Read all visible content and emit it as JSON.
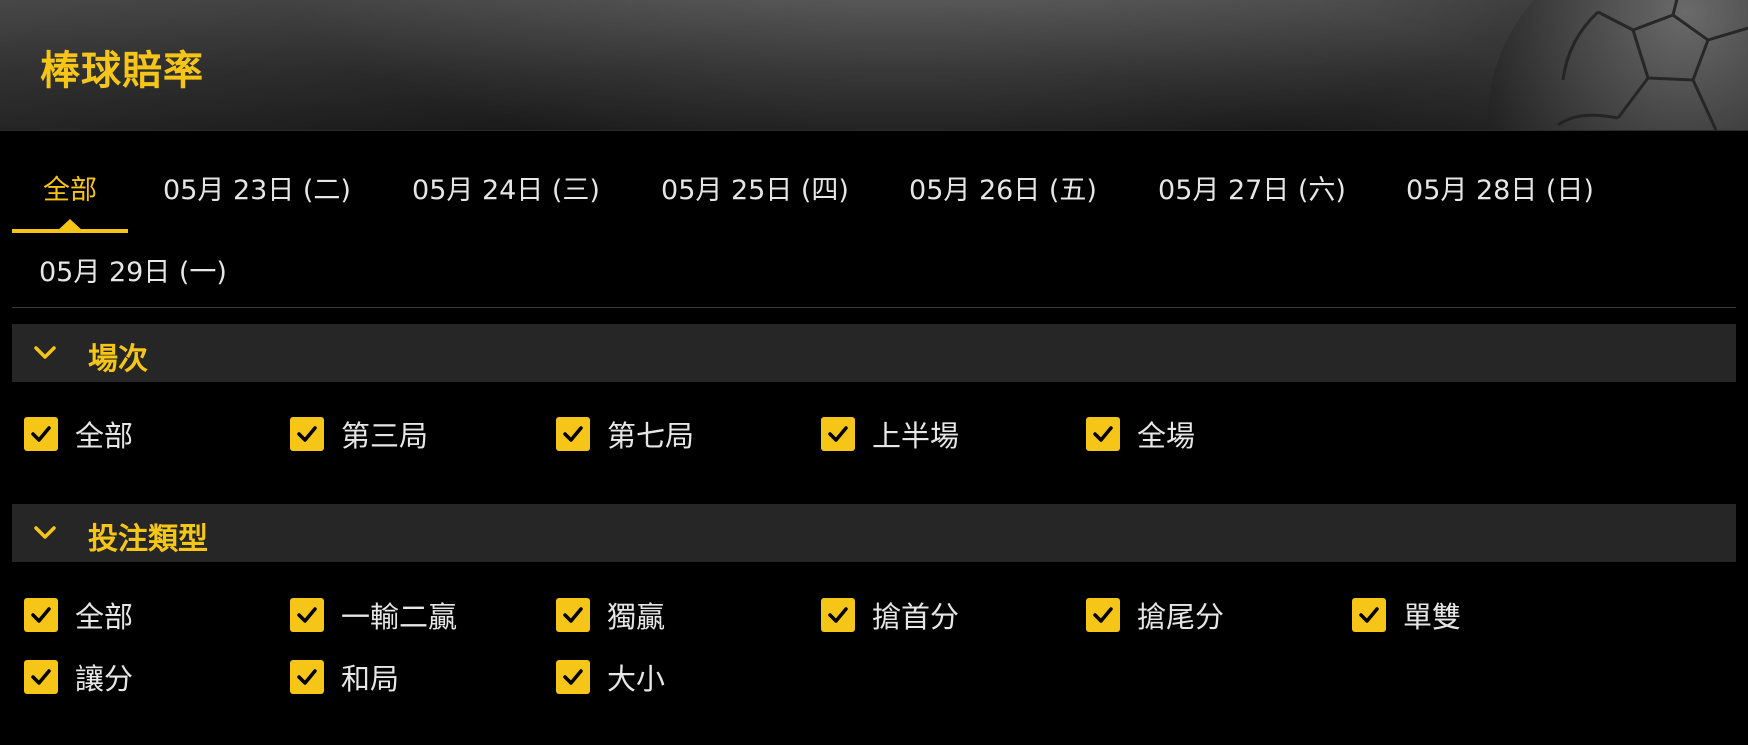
{
  "header": {
    "title": "棒球賠率"
  },
  "tabs": [
    {
      "label": "全部"
    },
    {
      "label": "05月 23日 (二)"
    },
    {
      "label": "05月 24日 (三)"
    },
    {
      "label": "05月 25日 (四)"
    },
    {
      "label": "05月 26日 (五)"
    },
    {
      "label": "05月 27日 (六)"
    },
    {
      "label": "05月 28日 (日)"
    },
    {
      "label": "05月 29日 (一)"
    }
  ],
  "sections": {
    "match": {
      "title": "場次",
      "options": [
        {
          "label": "全部",
          "checked": true
        },
        {
          "label": "第三局",
          "checked": true
        },
        {
          "label": "第七局",
          "checked": true
        },
        {
          "label": "上半場",
          "checked": true
        },
        {
          "label": "全場",
          "checked": true
        }
      ]
    },
    "bet_type": {
      "title": "投注類型",
      "options": [
        {
          "label": "全部",
          "checked": true
        },
        {
          "label": "一輸二贏",
          "checked": true
        },
        {
          "label": "獨贏",
          "checked": true
        },
        {
          "label": "搶首分",
          "checked": true
        },
        {
          "label": "搶尾分",
          "checked": true
        },
        {
          "label": "單雙",
          "checked": true
        },
        {
          "label": "讓分",
          "checked": true
        },
        {
          "label": "和局",
          "checked": true
        },
        {
          "label": "大小",
          "checked": true
        }
      ]
    }
  },
  "colors": {
    "accent": "#f5c518",
    "background": "#000000",
    "section_bg": "#262626",
    "text": "#e6e6e6"
  },
  "icons": {
    "chevron": "chevron-down-icon",
    "check": "check-icon",
    "ball": "soccer-ball-icon"
  }
}
